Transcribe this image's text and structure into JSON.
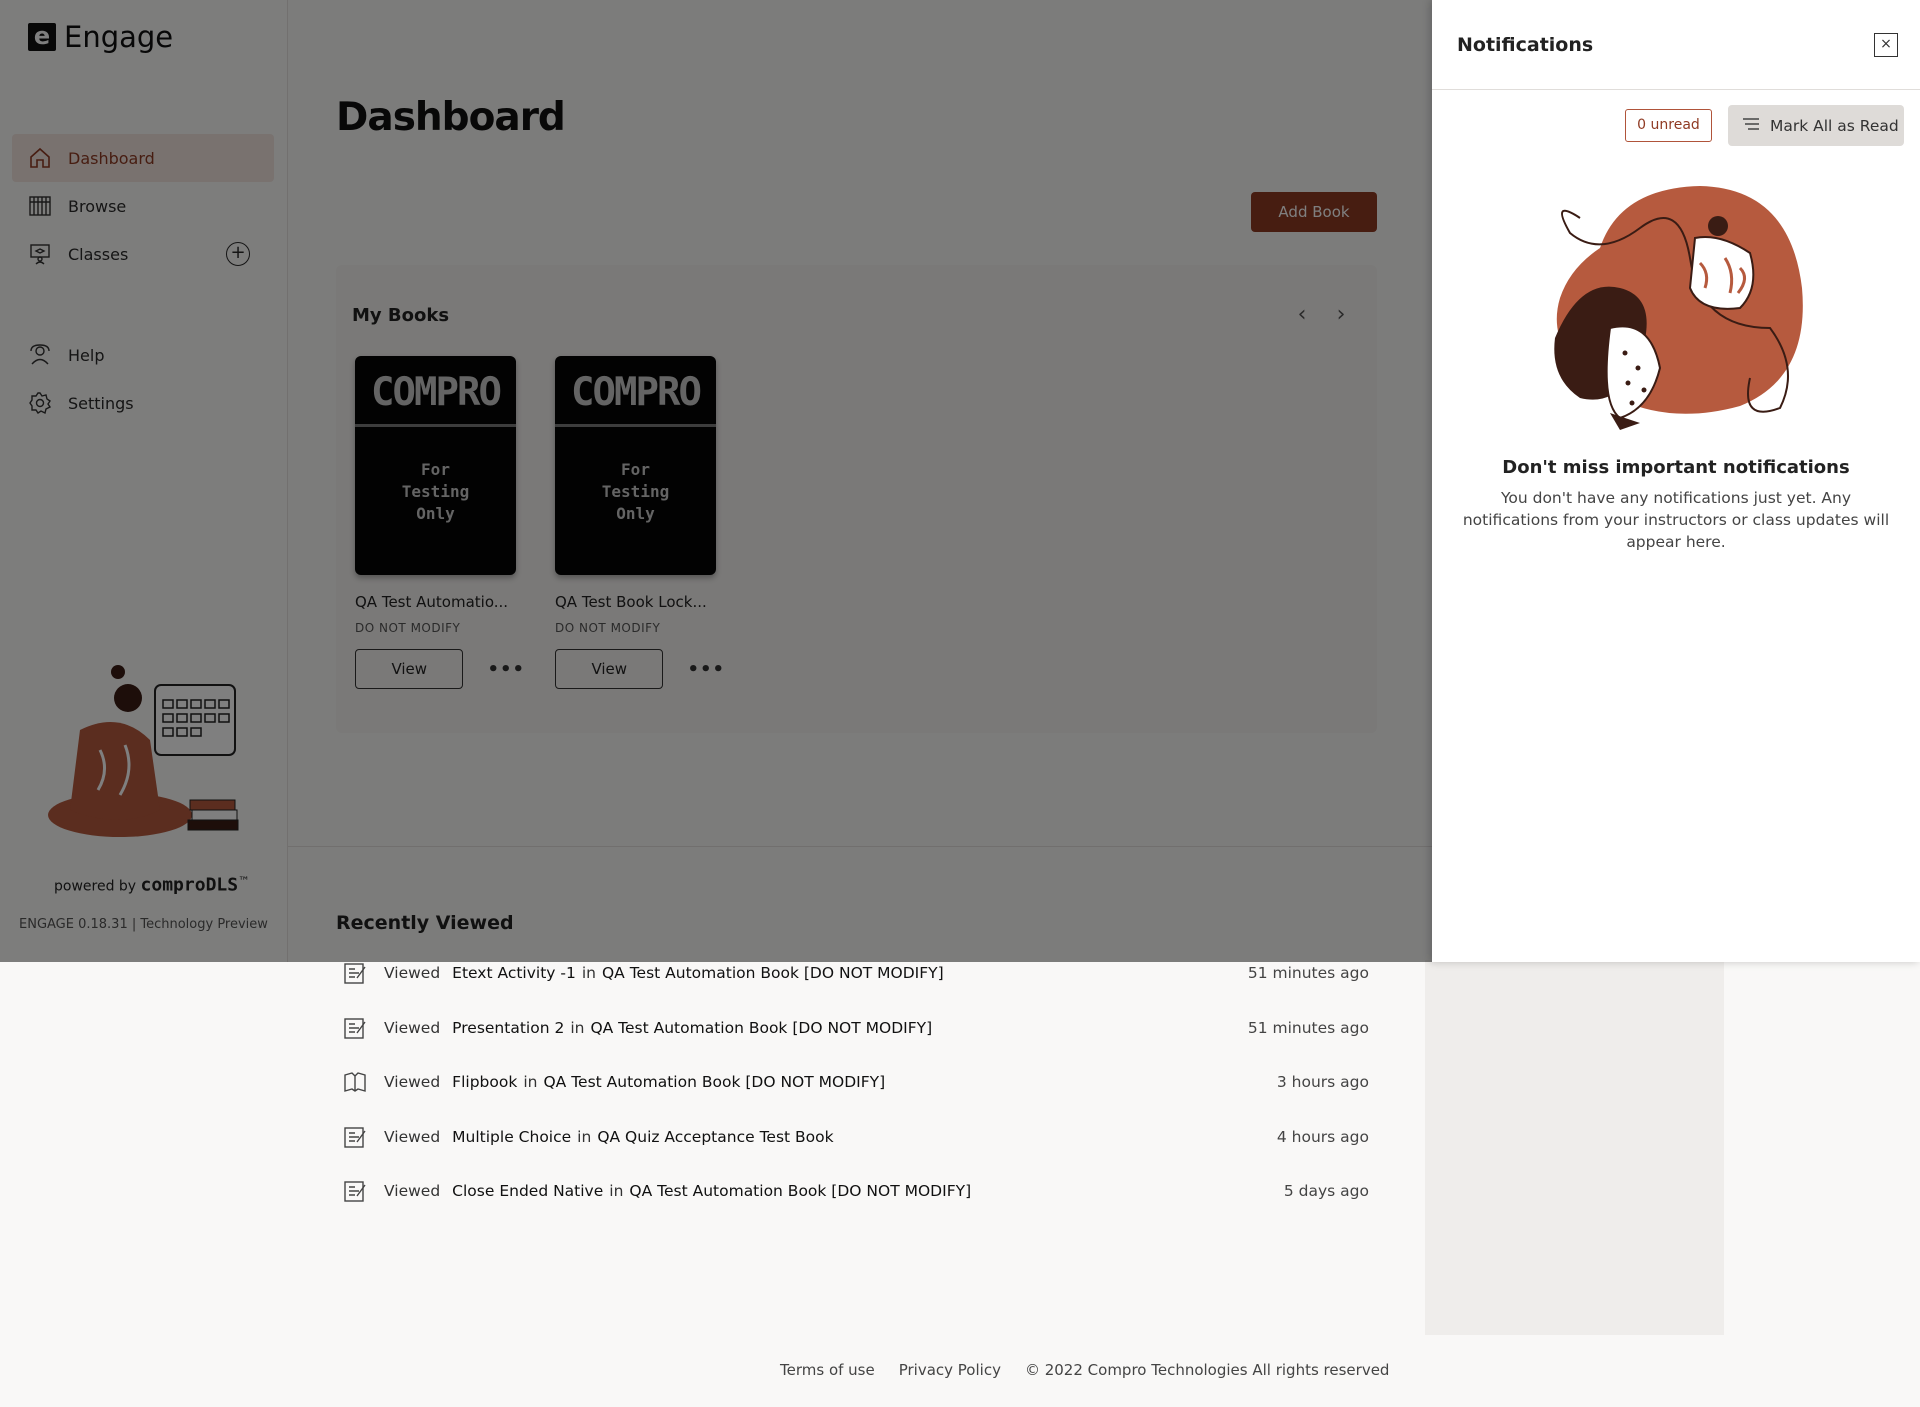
{
  "app": {
    "logo_letter": "e",
    "name": "Engage"
  },
  "sidebar": {
    "items": [
      {
        "label": "Dashboard",
        "icon": "home-icon",
        "active": true
      },
      {
        "label": "Browse",
        "icon": "library-icon"
      },
      {
        "label": "Classes",
        "icon": "classroom-icon"
      },
      {
        "label": "Help",
        "icon": "help-icon"
      },
      {
        "label": "Settings",
        "icon": "gear-icon"
      }
    ],
    "powered_prefix": "powered by",
    "powered_brand": "comproDLS",
    "powered_tm": "™",
    "version": "ENGAGE 0.18.31 | Technology Preview"
  },
  "main": {
    "title": "Dashboard",
    "add_book_label": "Add Book",
    "my_books": {
      "title": "My Books",
      "books": [
        {
          "cover_brand": "COMPRO",
          "cover_note_1": "For",
          "cover_note_2": "Testing",
          "cover_note_3": "Only",
          "title": "QA Test Automatio...",
          "subtitle": "DO NOT MODIFY",
          "view_label": "View",
          "more_label": "•••"
        },
        {
          "cover_brand": "COMPRO",
          "cover_note_1": "For",
          "cover_note_2": "Testing",
          "cover_note_3": "Only",
          "title": "QA Test Book Lock...",
          "subtitle": "DO NOT MODIFY",
          "view_label": "View",
          "more_label": "•••"
        }
      ]
    },
    "recently_viewed": {
      "title": "Recently Viewed",
      "items": [
        {
          "icon": "activity-icon",
          "verb": "Viewed",
          "item": "Etext Activity -1",
          "in": "in",
          "book": "QA Test Automation Book [DO NOT MODIFY]",
          "time": "51 minutes ago"
        },
        {
          "icon": "activity-icon",
          "verb": "Viewed",
          "item": "Presentation 2",
          "in": "in",
          "book": "QA Test Automation Book [DO NOT MODIFY]",
          "time": "51 minutes ago"
        },
        {
          "icon": "book-open-icon",
          "verb": "Viewed",
          "item": "Flipbook",
          "in": "in",
          "book": "QA Test Automation Book [DO NOT MODIFY]",
          "time": "3 hours ago"
        },
        {
          "icon": "activity-icon",
          "verb": "Viewed",
          "item": "Multiple Choice",
          "in": "in",
          "book": "QA Quiz Acceptance Test Book",
          "time": "4 hours ago"
        },
        {
          "icon": "activity-icon",
          "verb": "Viewed",
          "item": "Close Ended Native",
          "in": "in",
          "book": "QA Test Automation Book [DO NOT MODIFY]",
          "time": "5 days ago"
        }
      ]
    }
  },
  "footer": {
    "terms": "Terms of use",
    "privacy": "Privacy Policy",
    "copyright": "© 2022 Compro Technologies All rights reserved"
  },
  "notifications": {
    "title": "Notifications",
    "close_label": "×",
    "unread_badge": "0 unread",
    "mark_all_read": "Mark All as Read",
    "empty_title": "Don't miss important notifications",
    "empty_desc": "You don't have any notifications just yet. Any notifications from your instructors or class updates will appear here."
  },
  "colors": {
    "accent": "#8f3a23",
    "illustration": "#b65a3e",
    "dark": "#3a1c14"
  }
}
